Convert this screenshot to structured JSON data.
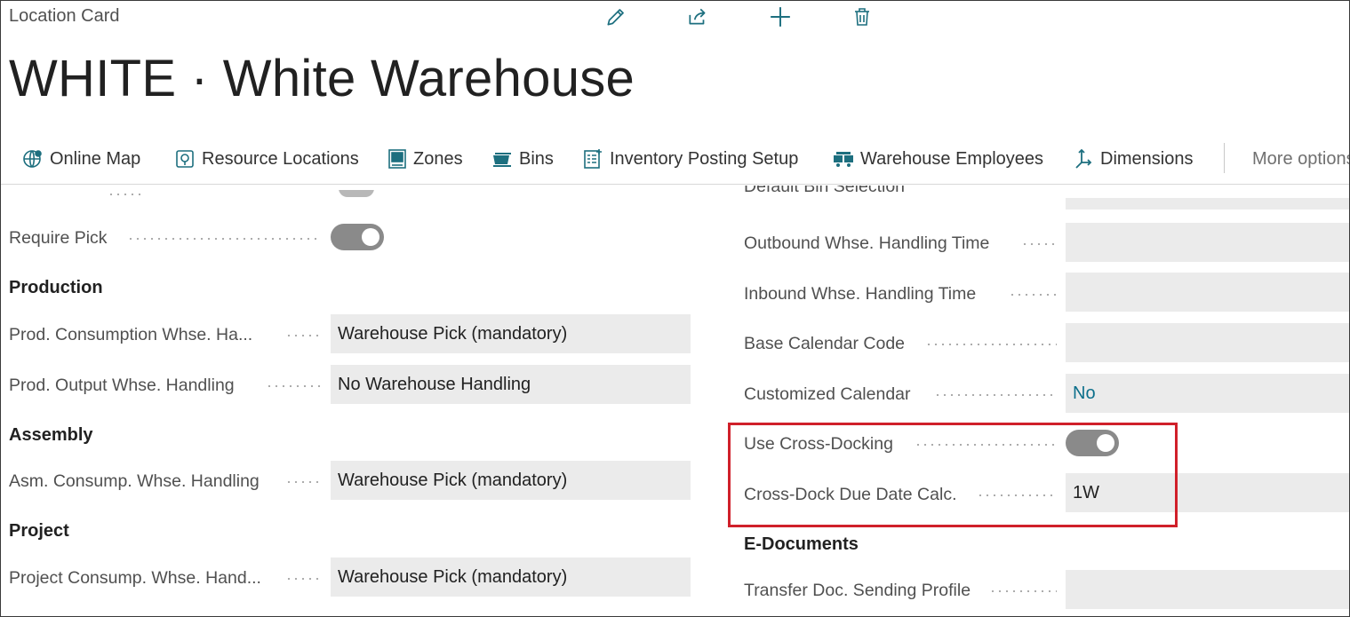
{
  "header": {
    "page_type": "Location Card",
    "title": "WHITE · White Warehouse",
    "actions": [
      "edit-icon",
      "share-icon",
      "add-icon",
      "delete-icon"
    ]
  },
  "actionbar": {
    "items": [
      {
        "label": "Online Map",
        "icon": "globe-icon"
      },
      {
        "label": "Resource Locations",
        "icon": "resource-location-icon"
      },
      {
        "label": "Zones",
        "icon": "zones-icon"
      },
      {
        "label": "Bins",
        "icon": "bins-icon"
      },
      {
        "label": "Inventory Posting Setup",
        "icon": "inventory-setup-icon"
      },
      {
        "label": "Warehouse Employees",
        "icon": "employees-icon"
      },
      {
        "label": "Dimensions",
        "icon": "dimensions-icon"
      }
    ],
    "more_label": "More options"
  },
  "left": {
    "require_pick": {
      "label": "Require Pick",
      "value": true
    },
    "production": {
      "title": "Production",
      "consumption": {
        "label": "Prod. Consumption Whse. Ha...",
        "value": "Warehouse Pick (mandatory)"
      },
      "output": {
        "label": "Prod. Output Whse. Handling",
        "value": "No Warehouse Handling"
      }
    },
    "assembly": {
      "title": "Assembly",
      "consumption": {
        "label": "Asm. Consump. Whse. Handling",
        "value": "Warehouse Pick (mandatory)"
      }
    },
    "project": {
      "title": "Project",
      "consumption": {
        "label": "Project Consump. Whse. Hand...",
        "value": "Warehouse Pick (mandatory)"
      }
    }
  },
  "right": {
    "clipped_label": "Default Bin Selection",
    "outbound": {
      "label": "Outbound Whse. Handling Time",
      "value": ""
    },
    "inbound": {
      "label": "Inbound Whse. Handling Time",
      "value": ""
    },
    "base_calendar": {
      "label": "Base Calendar Code",
      "value": ""
    },
    "customized_calendar": {
      "label": "Customized Calendar",
      "value": "No"
    },
    "cross_docking": {
      "label": "Use Cross-Docking",
      "value": true
    },
    "cross_dock_due": {
      "label": "Cross-Dock Due Date Calc.",
      "value": "1W"
    },
    "edocuments": {
      "title": "E-Documents",
      "transfer_profile": {
        "label": "Transfer Doc. Sending Profile",
        "value": ""
      }
    }
  },
  "colors": {
    "highlight": "#d0202a",
    "accent_link": "#0c6f8b",
    "toggle_on": "#8a8a8a",
    "field_bg": "#ebebeb"
  }
}
